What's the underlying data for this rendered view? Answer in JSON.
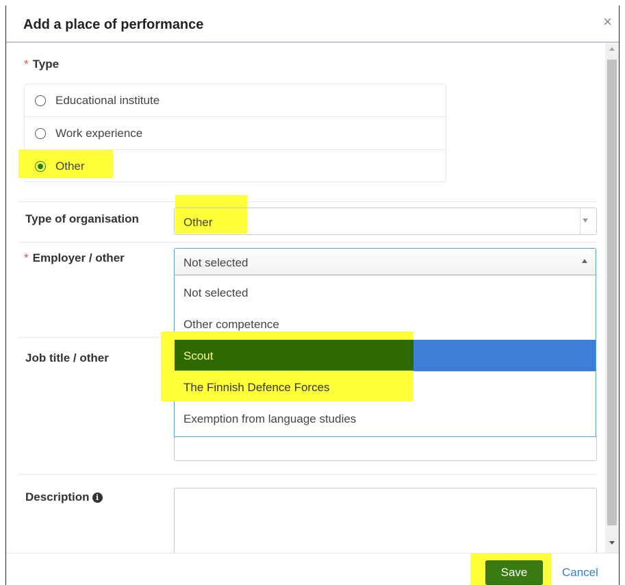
{
  "dialog": {
    "title": "Add a place of performance",
    "close_glyph": "×"
  },
  "type_field": {
    "label": "Type",
    "options": [
      {
        "label": "Educational institute",
        "selected": false
      },
      {
        "label": "Work experience",
        "selected": false
      },
      {
        "label": "Other",
        "selected": true
      }
    ]
  },
  "type_of_organisation": {
    "label": "Type of organisation",
    "value": "Other"
  },
  "employer": {
    "label": "Employer / other",
    "value": "Not selected",
    "options": [
      "Not selected",
      "Other competence",
      "Scout",
      "The Finnish Defence Forces",
      "Exemption from language studies"
    ],
    "hovered_option": "Scout"
  },
  "job_title": {
    "label": "Job title / other"
  },
  "description": {
    "label": "Description",
    "info_glyph": "i"
  },
  "footer": {
    "save_label": "Save",
    "cancel_label": "Cancel"
  },
  "colors": {
    "highlight": "#ffff3a",
    "save_button": "#3a7a12",
    "selected_option": "#3c7ed8",
    "required_marker": "#d9534f",
    "link": "#3a7fc1"
  }
}
